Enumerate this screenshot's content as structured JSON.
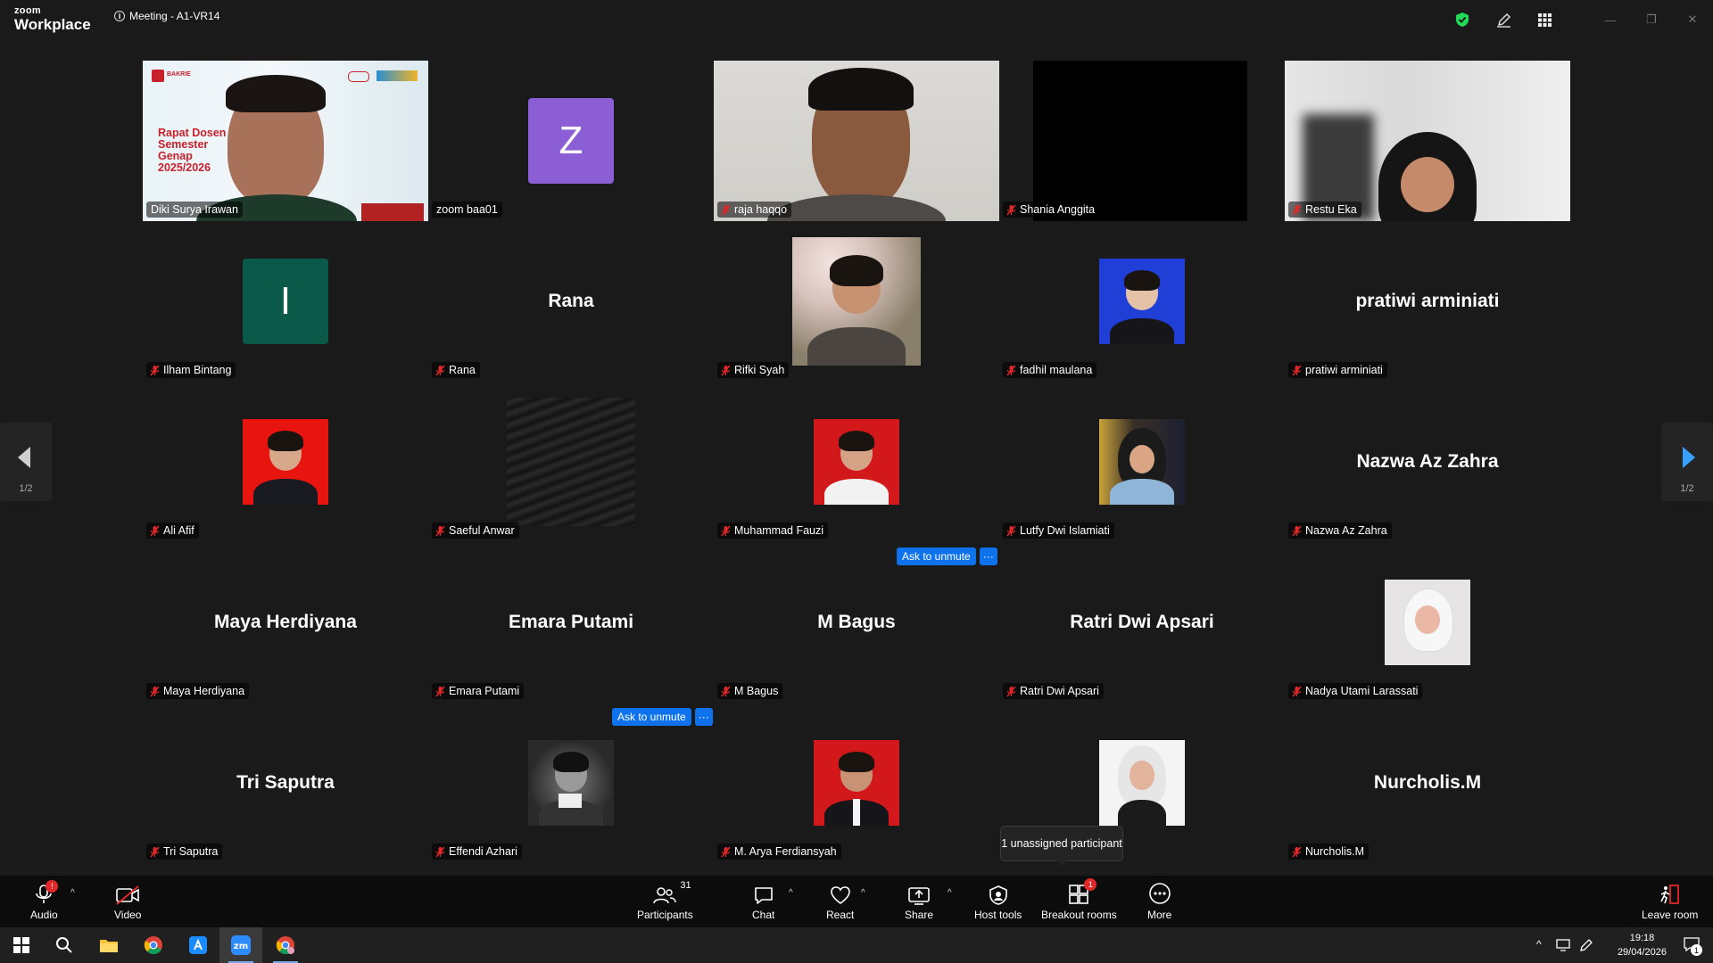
{
  "app": {
    "brand_small": "zoom",
    "brand_name": "Workplace",
    "meeting_title": "Meeting - A1-VR14"
  },
  "colors": {
    "active_speaker": "#23d959",
    "accent": "#0e72ed",
    "badge": "#e02828",
    "security": "#23d959"
  },
  "slide": {
    "title": "Rapat Dosen Semester Genap 2025/2026",
    "org": "BAKRIE"
  },
  "tiles": [
    {
      "name": "Diki Surya Irawan",
      "kind": "video",
      "muted": false
    },
    {
      "name": "zoom baa01",
      "kind": "initial",
      "initial": "Z",
      "initial_bg": "#8b5ed6",
      "muted": false
    },
    {
      "name": "raja haqqo",
      "kind": "video",
      "muted": true
    },
    {
      "name": "Shania Anggita",
      "kind": "video",
      "muted": true
    },
    {
      "name": "Restu Eka",
      "kind": "video",
      "muted": true
    },
    {
      "name": "Ilham Bintang",
      "kind": "initial",
      "initial": "I",
      "initial_bg": "#0b5948",
      "muted": true
    },
    {
      "name": "Rana",
      "kind": "name",
      "display": "Rana",
      "muted": true
    },
    {
      "name": "Rifki Syah",
      "kind": "photo",
      "muted": true
    },
    {
      "name": "fadhil maulana",
      "kind": "photo",
      "muted": true
    },
    {
      "name": "pratiwi arminiati",
      "kind": "name",
      "display": "pratiwi arminiati",
      "muted": true
    },
    {
      "name": "Ali Afif",
      "kind": "photo",
      "muted": true
    },
    {
      "name": "Saeful Anwar",
      "kind": "photo",
      "muted": true
    },
    {
      "name": "Muhammad Fauzi",
      "kind": "photo",
      "muted": true
    },
    {
      "name": "Lutfy Dwi Islamiati",
      "kind": "photo",
      "muted": true
    },
    {
      "name": "Nazwa Az Zahra",
      "kind": "name",
      "display": "Nazwa Az Zahra",
      "muted": true
    },
    {
      "name": "Maya Herdiyana",
      "kind": "name",
      "display": "Maya Herdiyana",
      "muted": true
    },
    {
      "name": "Emara Putami",
      "kind": "name",
      "display": "Emara Putami",
      "muted": true
    },
    {
      "name": "M Bagus",
      "kind": "name",
      "display": "M Bagus",
      "muted": true
    },
    {
      "name": "Ratri Dwi Apsari",
      "kind": "name",
      "display": "Ratri Dwi Apsari",
      "muted": true
    },
    {
      "name": "Nadya Utami Larassati",
      "kind": "photo",
      "muted": true
    },
    {
      "name": "Tri Saputra",
      "kind": "name",
      "display": "Tri Saputra",
      "muted": true
    },
    {
      "name": "Effendi Azhari",
      "kind": "photo",
      "muted": true
    },
    {
      "name": "M. Arya Ferdiansyah",
      "kind": "photo",
      "muted": true
    },
    {
      "name": "",
      "kind": "photo",
      "muted": false
    },
    {
      "name": "Nurcholis.M",
      "kind": "name",
      "display": "Nurcholis.M",
      "muted": true
    }
  ],
  "ask_to_unmute": {
    "label": "Ask to unmute",
    "more": "···"
  },
  "pagination": {
    "prev": "1/2",
    "next": "1/2"
  },
  "tooltip": "1 unassigned participant",
  "toolbar": {
    "audio": {
      "label": "Audio",
      "icon": "microphone-icon"
    },
    "video": {
      "label": "Video",
      "icon": "video-off-icon"
    },
    "participants": {
      "label": "Participants",
      "count": "31",
      "icon": "participants-icon"
    },
    "chat": {
      "label": "Chat",
      "icon": "chat-icon"
    },
    "react": {
      "label": "React",
      "icon": "heart-icon"
    },
    "share": {
      "label": "Share",
      "icon": "share-icon"
    },
    "host_tools": {
      "label": "Host tools",
      "icon": "shield-icon"
    },
    "breakout_rooms": {
      "label": "Breakout rooms",
      "badge": "1",
      "icon": "breakout-icon"
    },
    "more": {
      "label": "More",
      "icon": "more-icon"
    },
    "leave": {
      "label": "Leave room",
      "icon": "leave-icon"
    }
  },
  "taskbar": {
    "apps": [
      "windows-start-icon",
      "search-icon",
      "file-explorer-icon",
      "chrome-icon",
      "app-store-icon",
      "zoom-icon",
      "chrome-profile-icon"
    ],
    "time": "19:18",
    "date": "29/04/2026",
    "notifications": "1"
  }
}
